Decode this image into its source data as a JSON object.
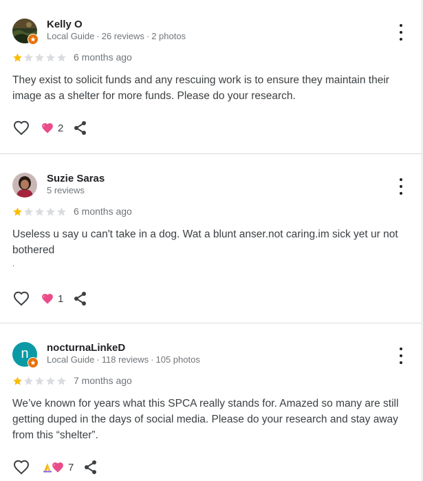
{
  "reviews": [
    {
      "author": "Kelly O",
      "meta": [
        "Local Guide",
        "26 reviews",
        "2 photos"
      ],
      "rating": 1,
      "time": "6 months ago",
      "text": "They exist to solicit funds and any rescuing work is to ensure they maintain their image as a shelter for more funds. Please do your research.",
      "reaction_count": "2",
      "avatar_icon": "photo-avatar",
      "local_guide": true
    },
    {
      "author": "Suzie Saras",
      "meta": [
        "5 reviews"
      ],
      "rating": 1,
      "time": "6 months ago",
      "text": "Useless u say u can't take in a dog. Wat a blunt anser.not caring.im sick yet ur not bothered",
      "text_extra": ".",
      "reaction_count": "1",
      "avatar_icon": "photo-avatar",
      "local_guide": false
    },
    {
      "author": "nocturnaLinkeD",
      "meta": [
        "Local Guide",
        "118 reviews",
        "105 photos"
      ],
      "avatar_letter": "n",
      "rating": 1,
      "time": "7 months ago",
      "text": "We’ve known for years what this SPCA really stands for. Amazed so many are still getting duped in the days of social media. Please do your research and stay away from this “shelter”.",
      "reaction_count": "7",
      "avatar_icon": "letter-avatar",
      "local_guide": true
    }
  ],
  "meta_separator": "·",
  "colors": {
    "star_filled": "#fbbc04",
    "star_empty": "#dadce0",
    "heart": "#ea4c89",
    "guide_badge": "#e8710a",
    "letter_avatar": "#0b9aa5",
    "meta_text": "#70757a",
    "divider": "#dadce0"
  },
  "icons": {
    "like": "heart-outline-icon",
    "reaction": "heart-reaction-icon",
    "pray_reaction": "folded-hands-icon",
    "share": "share-icon",
    "menu": "more-vert-icon",
    "star": "star-icon"
  }
}
